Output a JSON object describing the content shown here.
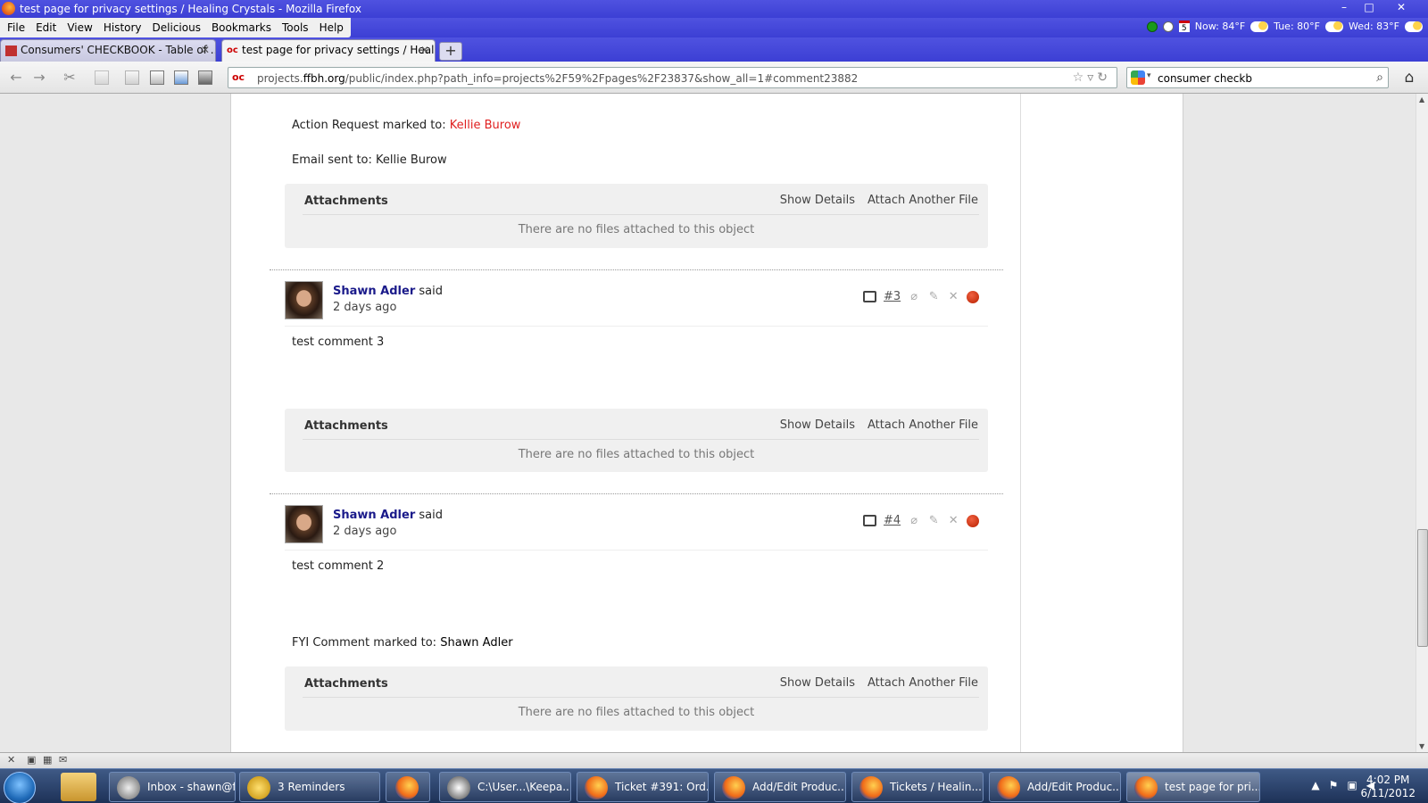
{
  "window": {
    "title": "test page for privacy settings / Healing Crystals - Mozilla Firefox",
    "controls": [
      "–",
      "□",
      "✕"
    ]
  },
  "menu": [
    "File",
    "Edit",
    "View",
    "History",
    "Delicious",
    "Bookmarks",
    "Tools",
    "Help"
  ],
  "status_icons": {
    "calendar_day": "5",
    "weather_now": "Now: 84°F",
    "weather_tue": "Tue: 80°F",
    "weather_wed": "Wed: 83°F"
  },
  "tabs": [
    {
      "label": "Consumers' CHECKBOOK - Table of ...",
      "active": false
    },
    {
      "label": "test page for privacy settings / Healin...",
      "active": true
    }
  ],
  "new_tab_label": "+",
  "urlbar": {
    "prefix": "projects.",
    "domain": "ffbh.org",
    "path": "/public/index.php?path_info=projects%2F59%2Fpages%2F23837&show_all=1#comment23882"
  },
  "search": {
    "value": "consumer checkb"
  },
  "content": {
    "action_request_label": "Action Request marked to:",
    "action_request_person": "Kellie Burow",
    "email_sent": "Email sent to: Kellie Burow",
    "attachments_sections": [
      {
        "title": "Attachments",
        "show_details": "Show Details",
        "attach_another": "Attach Another File",
        "empty": "There are no files attached to this object"
      },
      {
        "title": "Attachments",
        "show_details": "Show Details",
        "attach_another": "Attach Another File",
        "empty": "There are no files attached to this object"
      },
      {
        "title": "Attachments",
        "show_details": "Show Details",
        "attach_another": "Attach Another File",
        "empty": "There are no files attached to this object"
      }
    ],
    "comments": [
      {
        "author": "Shawn Adler",
        "said": "said",
        "when": "2 days ago",
        "number": "#3",
        "body": "test comment 3"
      },
      {
        "author": "Shawn Adler",
        "said": "said",
        "when": "2 days ago",
        "number": "#4",
        "body": "test comment 2"
      }
    ],
    "fyi_label": "FYI Comment marked to:",
    "fyi_person": "Shawn Adler"
  },
  "taskbar": {
    "tasks": [
      {
        "label": "Inbox - shawn@f...",
        "active": false
      },
      {
        "label": "3 Reminders",
        "active": false
      },
      {
        "label": "",
        "active": false
      },
      {
        "label": "C:\\User...\\Keepa...",
        "active": false
      },
      {
        "label": "Ticket #391: Ord...",
        "active": false
      },
      {
        "label": "Add/Edit Produc...",
        "active": false
      },
      {
        "label": "Tickets / Healin...",
        "active": false
      },
      {
        "label": "Add/Edit Produc...",
        "active": false
      },
      {
        "label": "test page for pri...",
        "active": true
      }
    ],
    "time": "4:02 PM",
    "date": "6/11/2012"
  },
  "colors": {
    "titlebar": "#3c3fd4",
    "link_red": "#e02020",
    "author_blue": "#1a1a8a",
    "attachments_bg": "#f0f0f0"
  }
}
